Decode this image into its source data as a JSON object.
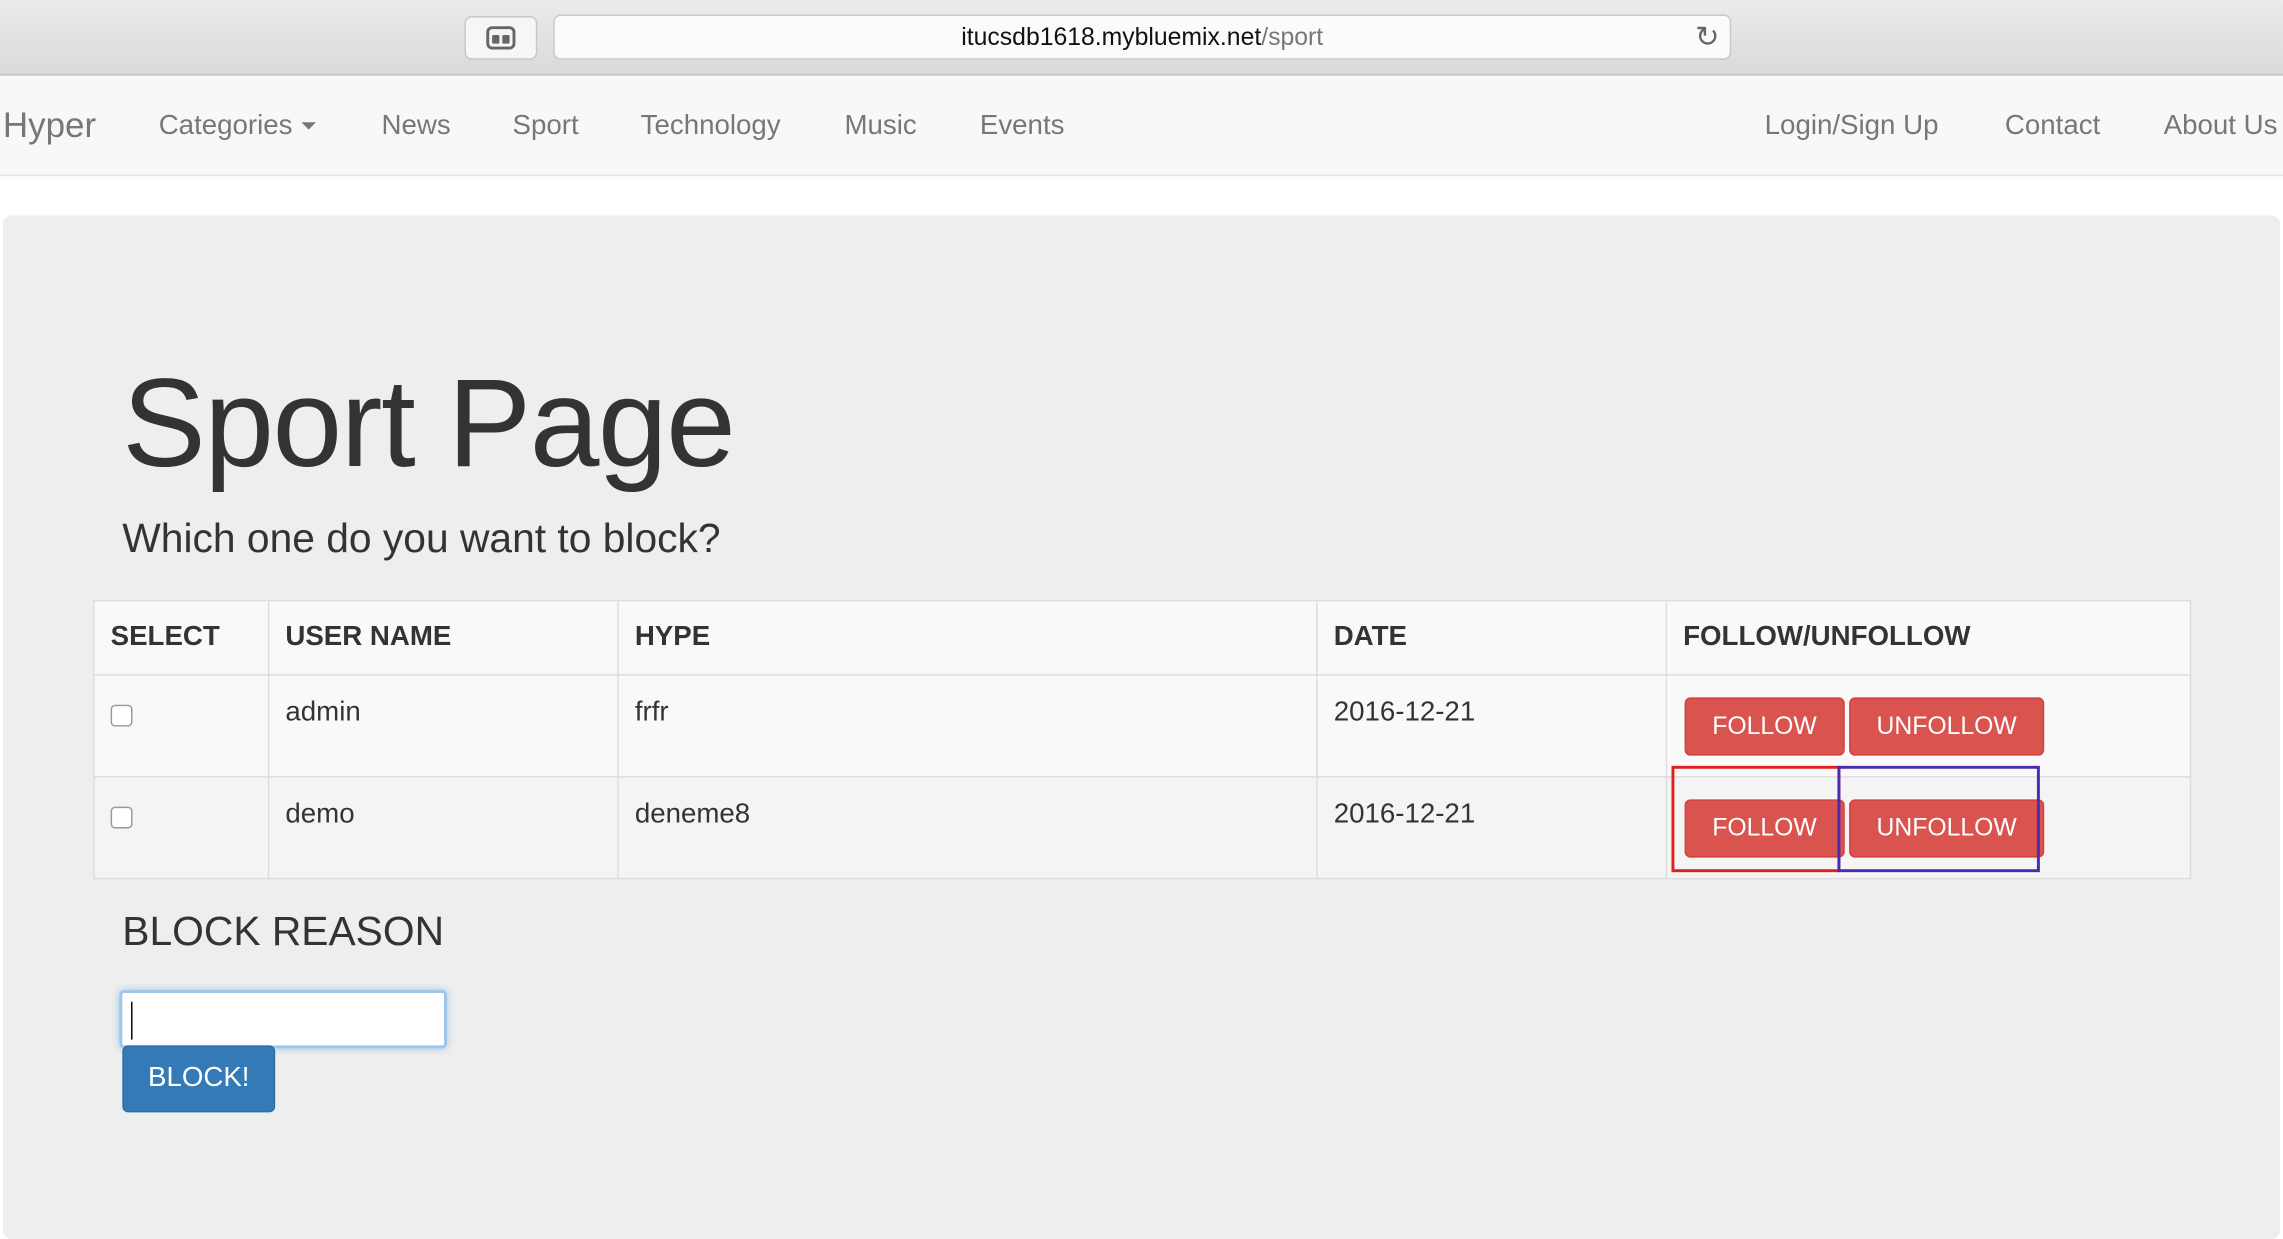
{
  "browser": {
    "url_host": "itucsdb1618.mybluemix.net",
    "url_path": "/sport",
    "reload_icon": "reload-icon",
    "tab_icon": "tab-overview-icon"
  },
  "navbar": {
    "brand": "Hyper",
    "left_items": [
      "Categories",
      "News",
      "Sport",
      "Technology",
      "Music",
      "Events"
    ],
    "right_items": [
      "Login/Sign Up",
      "Contact",
      "About Us"
    ]
  },
  "main": {
    "title": "Sport Page",
    "subtitle": "Which one do you want to block?",
    "table": {
      "headers": [
        "SELECT",
        "USER NAME",
        "HYPE",
        "DATE",
        "FOLLOW/UNFOLLOW"
      ],
      "rows": [
        {
          "user": "admin",
          "hype": "frfr",
          "date": "2016-12-21",
          "checked": false
        },
        {
          "user": "demo",
          "hype": "deneme8",
          "date": "2016-12-21",
          "checked": false
        }
      ],
      "follow_label": "FOLLOW",
      "unfollow_label": "UNFOLLOW"
    },
    "block_reason_label": "BLOCK REASON",
    "block_reason_value": "",
    "block_button": "BLOCK!"
  },
  "colors": {
    "danger": "#d9534f",
    "primary": "#337ab7",
    "highlight_red": "#e02020",
    "highlight_purple": "#4a2ab0"
  }
}
